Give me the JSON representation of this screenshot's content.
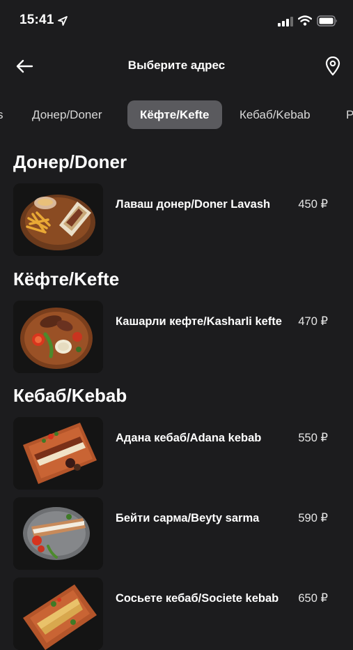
{
  "status_bar": {
    "time": "15:41"
  },
  "header": {
    "title": "Выберите адрес"
  },
  "tabs": [
    {
      "label": "s"
    },
    {
      "label": "Донер/Doner"
    },
    {
      "label": "Кёфте/Kefte",
      "active": true
    },
    {
      "label": "Кебаб/Kebab"
    },
    {
      "label": "P"
    }
  ],
  "sections": [
    {
      "title": "Донер/Doner",
      "items": [
        {
          "name": "Лаваш донер/Doner Lavash",
          "price": "450 ₽"
        }
      ]
    },
    {
      "title": "Кёфте/Kefte",
      "items": [
        {
          "name": "Кашарли кефте/Kasharli kefte",
          "price": "470 ₽"
        }
      ]
    },
    {
      "title": "Кебаб/Kebab",
      "items": [
        {
          "name": "Адана кебаб/Adana kebab",
          "price": "550 ₽"
        },
        {
          "name": "Бейти сарма/Beyty sarma",
          "price": "590 ₽"
        },
        {
          "name": "Сосьете кебаб/Societe kebab",
          "price": "650 ₽"
        }
      ]
    }
  ],
  "colors": {
    "background": "#1c1c1e",
    "active_tab": "#5a5a5e",
    "text": "#ffffff"
  },
  "icons": {
    "back": "arrow-left-icon",
    "location": "map-pin-icon",
    "status_location": "location-arrow-icon",
    "signal": "cellular-signal-icon",
    "wifi": "wifi-icon",
    "battery": "battery-icon"
  }
}
